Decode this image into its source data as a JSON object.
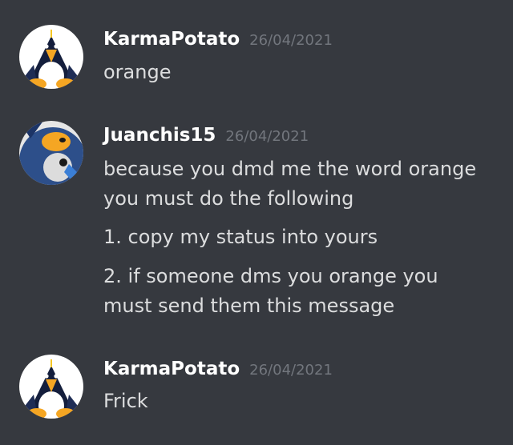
{
  "messages": [
    {
      "author": "KarmaPotato",
      "timestamp": "26/04/2021",
      "avatar_icon": "penguin-avatar-icon",
      "lines": [
        "orange"
      ]
    },
    {
      "author": "Juanchis15",
      "timestamp": "26/04/2021",
      "avatar_icon": "penguin-avatar-icon",
      "lines": [
        "because you dmd me the word orange",
        "you must do the following",
        "1. copy my status into yours",
        "2. if someone dms you orange you",
        "must send them this message"
      ]
    },
    {
      "author": "KarmaPotato",
      "timestamp": "26/04/2021",
      "avatar_icon": "penguin-avatar-icon",
      "lines": [
        "Frick"
      ]
    }
  ],
  "colors": {
    "background": "#36393f",
    "username": "#ffffff",
    "timestamp": "#72767d",
    "message_text": "#dcddde"
  }
}
